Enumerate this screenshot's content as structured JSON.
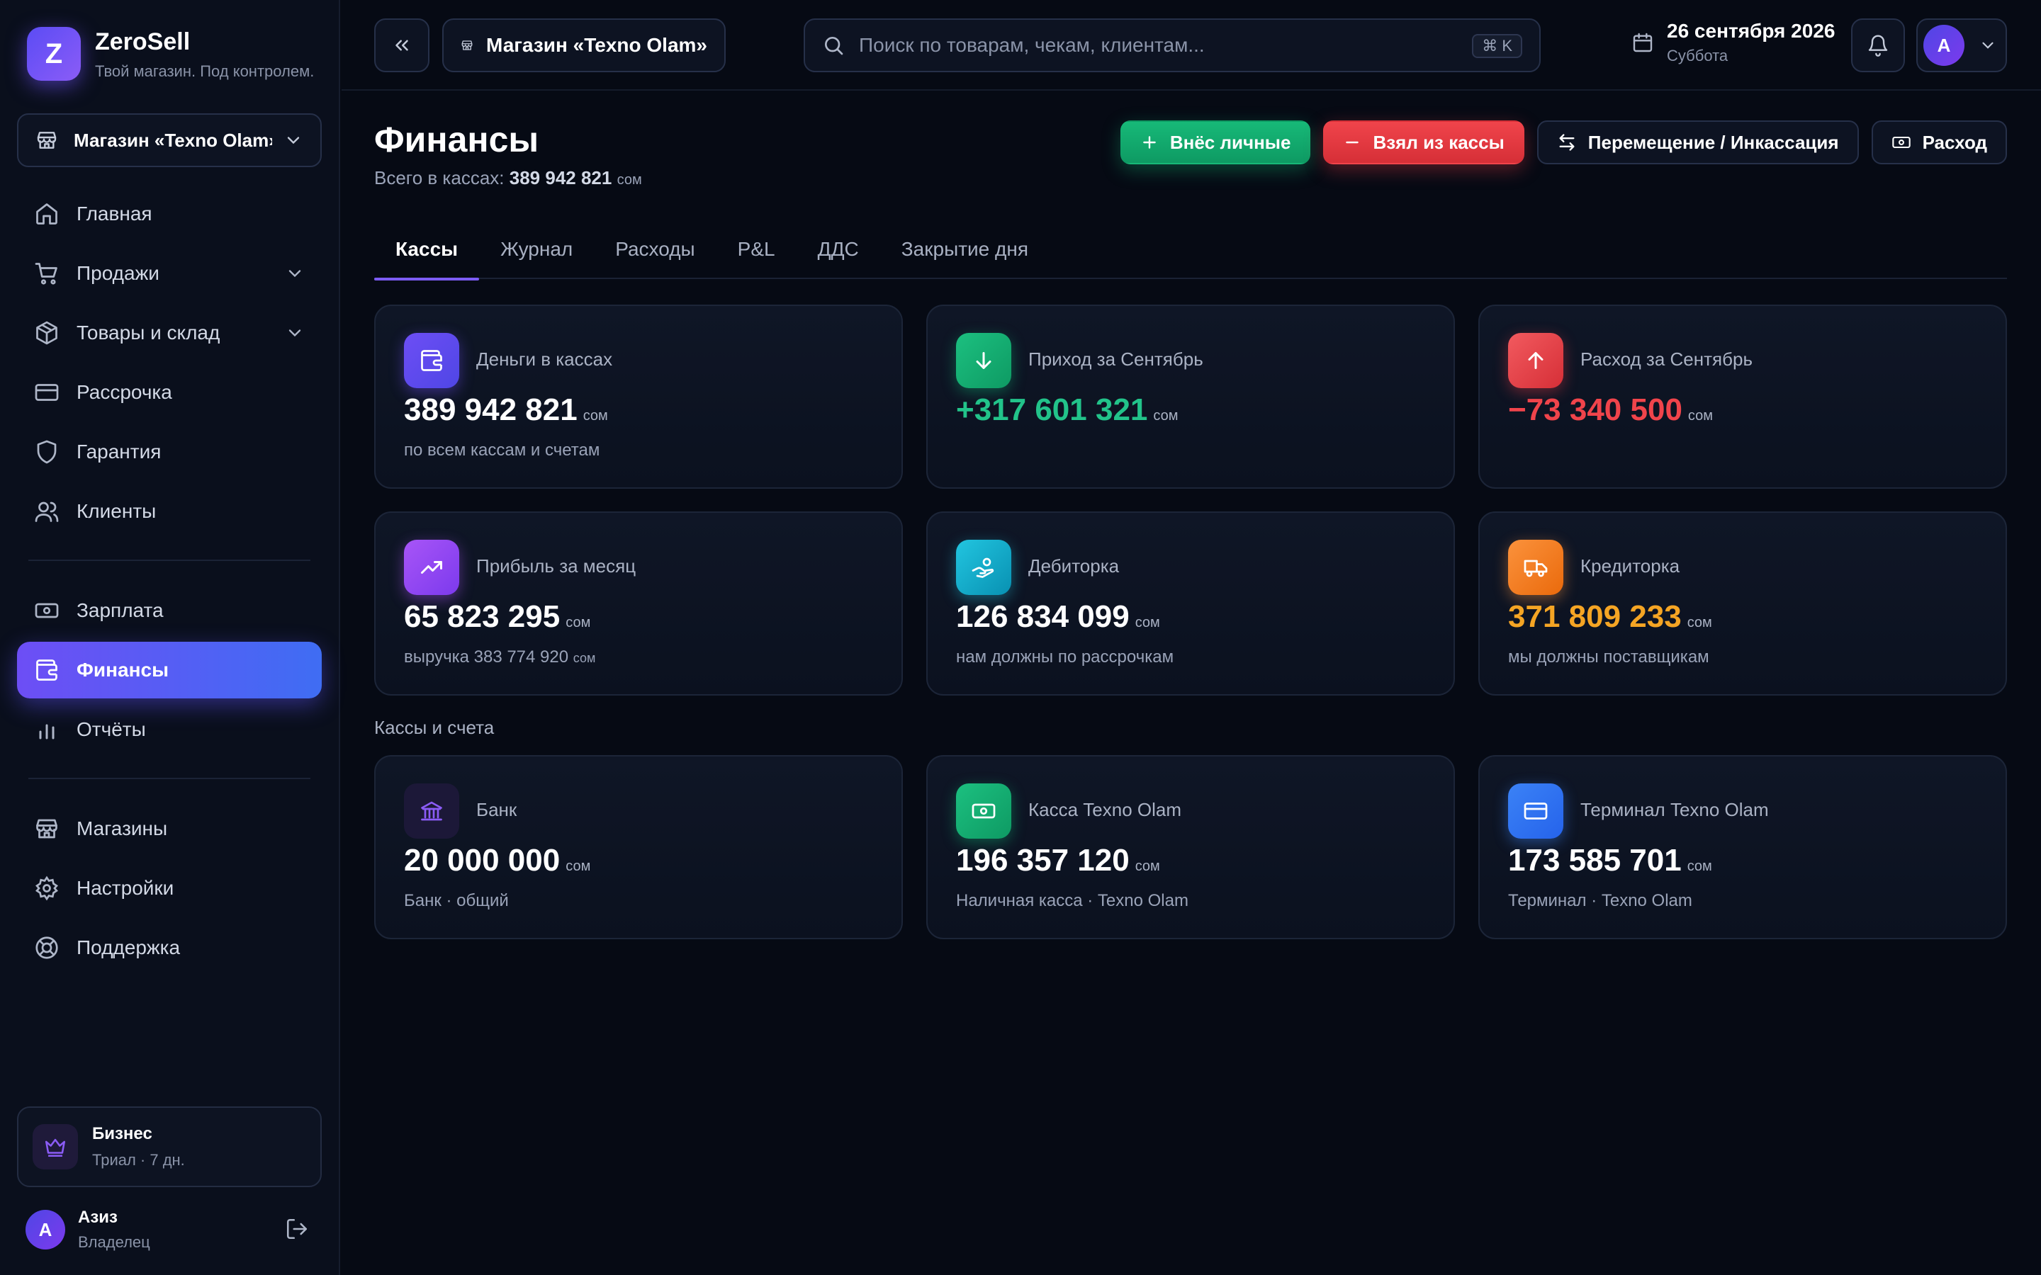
{
  "brand": {
    "name": "ZeroSell",
    "tagline": "Твой магазин. Под контролем.",
    "logo_letter": "Z"
  },
  "sidebar": {
    "store_select": "Магазин «Texno Olam»",
    "items": [
      {
        "label": "Главная",
        "icon": "home-icon"
      },
      {
        "label": "Продажи",
        "icon": "cart-icon",
        "expandable": true
      },
      {
        "label": "Товары и склад",
        "icon": "box-icon",
        "expandable": true
      },
      {
        "label": "Рассрочка",
        "icon": "card-icon"
      },
      {
        "label": "Гарантия",
        "icon": "shield-icon"
      },
      {
        "label": "Клиенты",
        "icon": "users-icon"
      },
      {
        "label": "Зарплата",
        "icon": "cash-icon"
      },
      {
        "label": "Финансы",
        "icon": "wallet-icon",
        "active": true
      },
      {
        "label": "Отчёты",
        "icon": "chart-icon"
      },
      {
        "label": "Магазины",
        "icon": "store-icon"
      },
      {
        "label": "Настройки",
        "icon": "gear-icon"
      },
      {
        "label": "Поддержка",
        "icon": "lifebuoy-icon"
      }
    ],
    "plan": {
      "title": "Бизнес",
      "subtitle": "Триал · 7 дн.",
      "icon": "crown-icon"
    },
    "user": {
      "initial": "А",
      "name": "Азиз",
      "role": "Владелец"
    }
  },
  "topbar": {
    "store_chip": "Магазин «Texno Olam»",
    "search_placeholder": "Поиск по товарам, чекам, клиентам...",
    "shortcut": "⌘ K",
    "date": "26 сентября 2026",
    "weekday": "Суббота",
    "profile_initial": "A"
  },
  "page": {
    "title": "Финансы",
    "subtitle_prefix": "Всего в кассах:",
    "subtitle_value": "389 942 821",
    "currency": "сом",
    "actions": {
      "deposit": "Внёс личные",
      "withdraw": "Взял из кассы",
      "transfer": "Перемещение / Инкассация",
      "expense": "Расход"
    },
    "tabs": [
      "Кассы",
      "Журнал",
      "Расходы",
      "P&L",
      "ДДС",
      "Закрытие дня"
    ],
    "active_tab": "Кассы"
  },
  "summary_cards": [
    {
      "label": "Деньги в кассах",
      "value": "389 942 821",
      "note": "по всем кассам и счетам",
      "icon": "wallet-icon",
      "color": "#6d4ef5"
    },
    {
      "label": "Приход за Сентябрь",
      "value": "+317 601 321",
      "note": "",
      "icon": "arrow-down-icon",
      "color": "#22c38a"
    },
    {
      "label": "Расход за Сентябрь",
      "value": "−73 340 500",
      "note": "",
      "icon": "arrow-up-icon",
      "color": "#f0444b"
    },
    {
      "label": "Прибыль за месяц",
      "value": "65 823 295",
      "note_prefix": "выручка 383 774 920",
      "note": "сом",
      "icon": "trend-up-icon",
      "color": "#a855f7"
    },
    {
      "label": "Дебиторка",
      "value": "126 834 099",
      "note": "нам должны по рассрочкам",
      "icon": "hand-coins-icon",
      "color": "#22c5e0"
    },
    {
      "label": "Кредиторка",
      "value": "371 809 233",
      "note": "мы должны поставщикам",
      "icon": "truck-icon",
      "color": "#f5a524"
    }
  ],
  "accounts_section_title": "Кассы и счета",
  "accounts": [
    {
      "label": "Банк",
      "value": "20 000 000",
      "note": "Банк · общий",
      "icon": "bank-icon"
    },
    {
      "label": "Касса Texno Olam",
      "value": "196 357 120",
      "note": "Наличная касса · Texno Olam",
      "icon": "cash-icon"
    },
    {
      "label": "Терминал Texno Olam",
      "value": "173 585 701",
      "note": "Терминал · Texno Olam",
      "icon": "card-icon"
    }
  ]
}
